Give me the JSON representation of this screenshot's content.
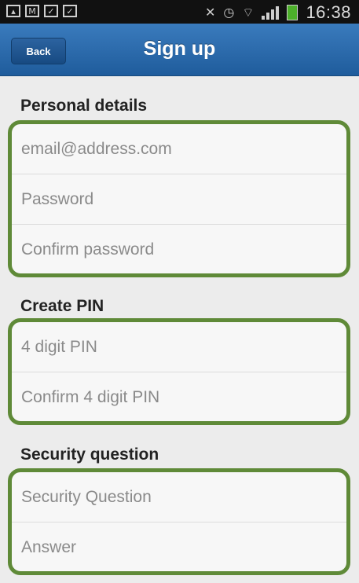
{
  "statusbar": {
    "time": "16:38"
  },
  "header": {
    "back_label": "Back",
    "title": "Sign up"
  },
  "sections": [
    {
      "heading": "Personal details",
      "fields": [
        {
          "placeholder": "email@address.com"
        },
        {
          "placeholder": "Password"
        },
        {
          "placeholder": "Confirm password"
        }
      ]
    },
    {
      "heading": "Create PIN",
      "fields": [
        {
          "placeholder": "4 digit PIN"
        },
        {
          "placeholder": "Confirm 4 digit PIN"
        }
      ]
    },
    {
      "heading": "Security question",
      "fields": [
        {
          "placeholder": "Security Question"
        },
        {
          "placeholder": "Answer"
        }
      ]
    }
  ],
  "colors": {
    "header_top": "#3a7bbd",
    "header_bottom": "#1f5c9c",
    "group_border": "#5f8a38",
    "battery": "#4caf2a"
  }
}
